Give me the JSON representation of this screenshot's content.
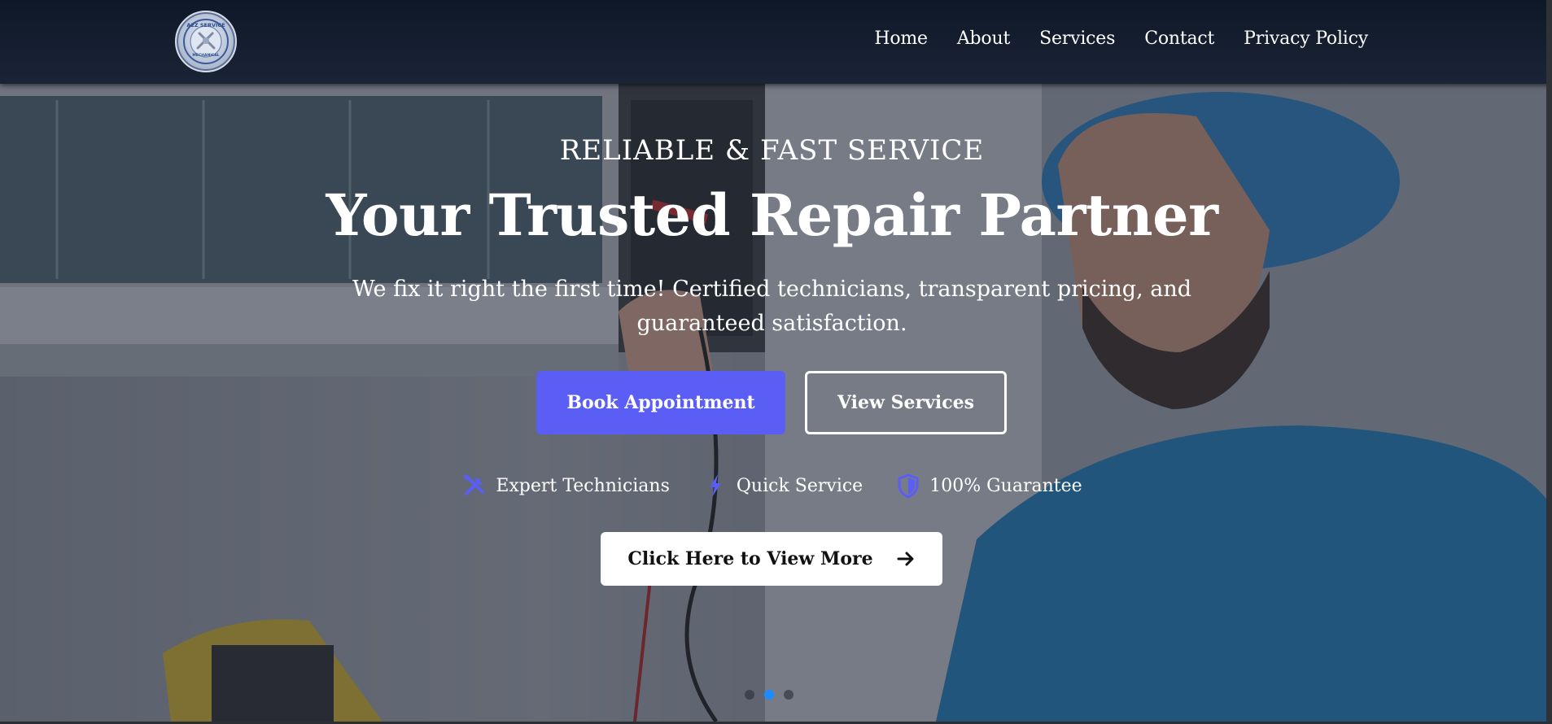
{
  "brand": {
    "logo_icon": "wrench-gear-badge-logo",
    "logo_text_top": "A2Z SERVICE",
    "logo_text_bottom": "MECHANICAL"
  },
  "nav": {
    "items": [
      {
        "label": "Home"
      },
      {
        "label": "About"
      },
      {
        "label": "Services"
      },
      {
        "label": "Contact"
      },
      {
        "label": "Privacy Policy"
      }
    ]
  },
  "hero": {
    "eyebrow": "RELIABLE & FAST SERVICE",
    "headline": "Your Trusted Repair Partner",
    "subtitle": "We fix it right the first time! Certified technicians, transparent pricing, and guaranteed satisfaction.",
    "primary_button": "Book Appointment",
    "secondary_button": "View Services",
    "features": [
      {
        "icon": "tools-icon",
        "label": "Expert Technicians"
      },
      {
        "icon": "bolt-icon",
        "label": "Quick Service"
      },
      {
        "icon": "shield-icon",
        "label": "100% Guarantee"
      }
    ],
    "more_button": "Click Here to View More",
    "more_button_icon": "arrow-right-icon",
    "slider": {
      "slide_count": 3,
      "active_index": 1
    }
  },
  "colors": {
    "accent": "#5b5ef4",
    "header_bg": "#0e1828",
    "active_dot": "#1a8cff"
  }
}
